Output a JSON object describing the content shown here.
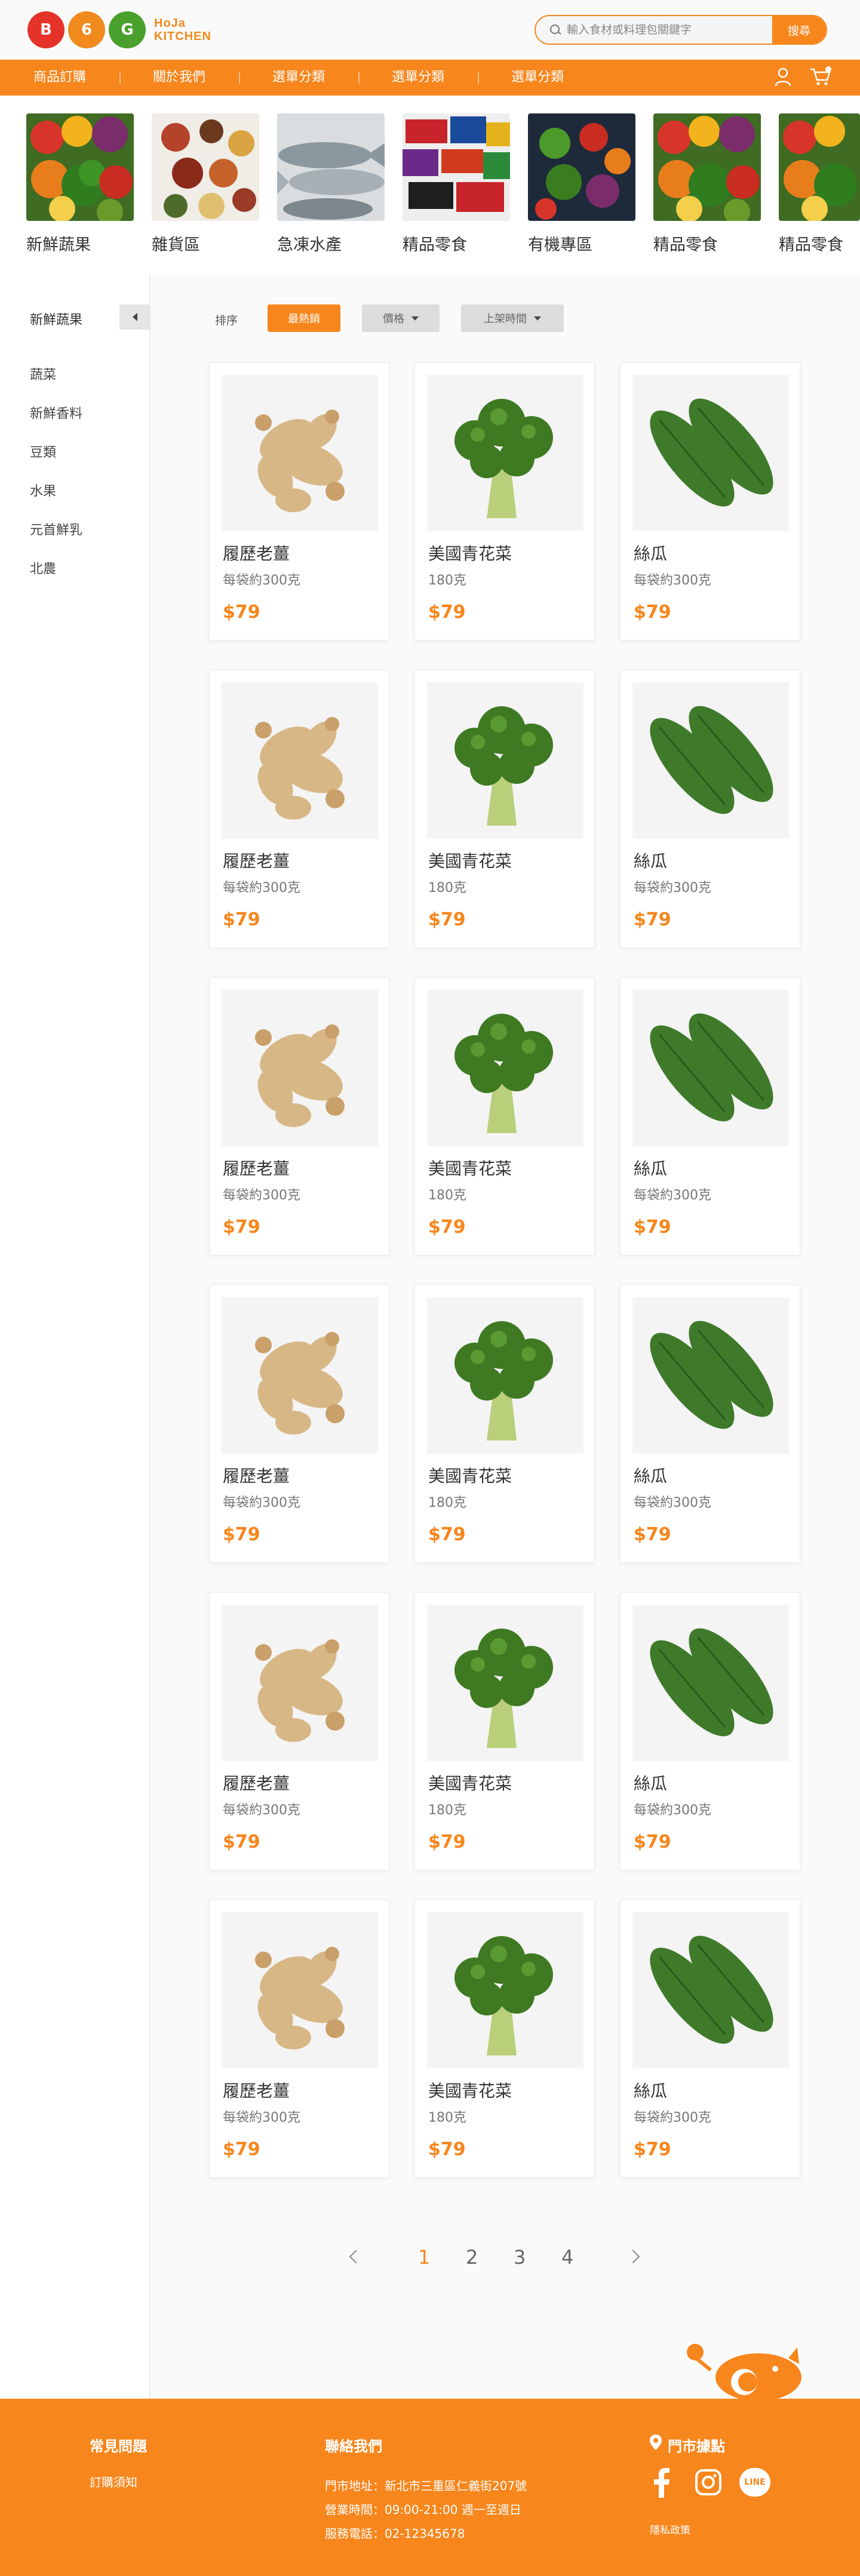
{
  "header": {
    "brand_line1": "HoJa",
    "brand_line2": "KITCHEN",
    "logo_letters": [
      "B",
      "6",
      "G"
    ],
    "search_placeholder": "輸入食材或料理包關鍵字",
    "search_button": "搜尋"
  },
  "nav": {
    "items": [
      "商品訂購",
      "關於我們",
      "選單分類",
      "選單分類",
      "選單分類"
    ]
  },
  "categories": [
    {
      "label": "新鮮蔬果",
      "icon": "vegetables-photo"
    },
    {
      "label": "雜貨區",
      "icon": "spices-photo"
    },
    {
      "label": "急凍水產",
      "icon": "fish-photo"
    },
    {
      "label": "精品零食",
      "icon": "snacks-photo"
    },
    {
      "label": "有機專區",
      "icon": "organic-produce-photo"
    },
    {
      "label": "精品零食",
      "icon": "vegetables-photo"
    },
    {
      "label": "精品零食",
      "icon": "vegetables-photo"
    }
  ],
  "sidebar": {
    "title": "新鮮蔬果",
    "items": [
      "蔬菜",
      "新鮮香料",
      "豆類",
      "水果",
      "元首鮮乳",
      "北農"
    ]
  },
  "sort": {
    "label": "排序",
    "options": [
      "最熱銷",
      "價格",
      "上架時間"
    ],
    "active": "最熱銷"
  },
  "products": [
    {
      "name": "履歷老薑",
      "desc": "每袋約300克",
      "price": "$79",
      "img": "ginger"
    },
    {
      "name": "美國青花菜",
      "desc": "180克",
      "price": "$79",
      "img": "broccoli"
    },
    {
      "name": "絲瓜",
      "desc": "每袋約300克",
      "price": "$79",
      "img": "loofah"
    }
  ],
  "pagination": {
    "pages": [
      "1",
      "2",
      "3",
      "4"
    ],
    "current": "1"
  },
  "footer": {
    "faq_title": "常見問題",
    "faq_item": "訂購須知",
    "contact_title": "聯絡我們",
    "address": "門市地址：新北市三重區仁義街207號",
    "hours": "營業時間：09:00-21:00 週一至週日",
    "phone": "服務電話：02-12345678",
    "stores_title": "門市據點",
    "privacy": "隱私政策",
    "line_label": "LINE"
  },
  "colors": {
    "accent": "#f7861c",
    "text": "#333333",
    "muted": "#777777"
  }
}
